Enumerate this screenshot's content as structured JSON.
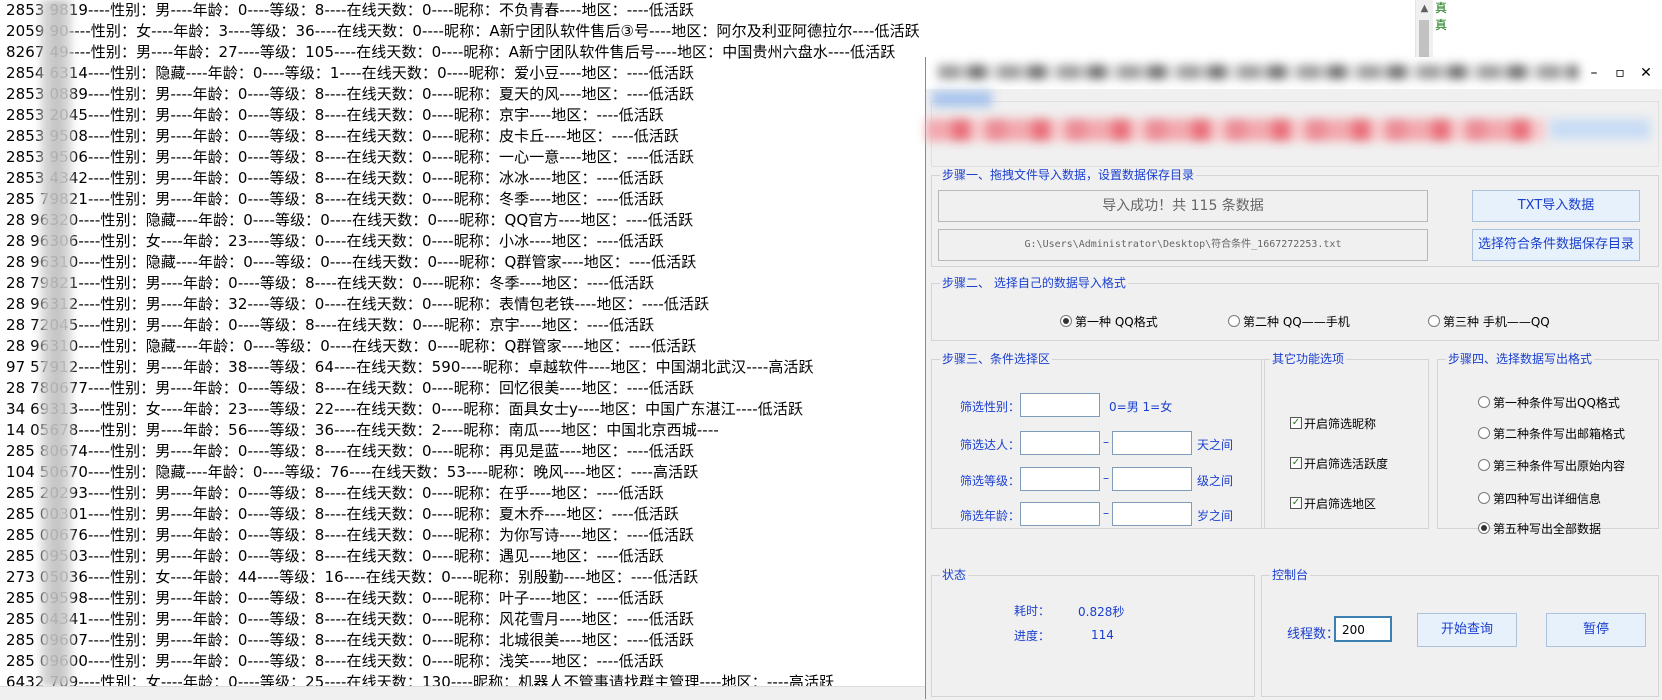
{
  "log_lines": [
    "2853  9819----性别：男----年龄：0----等级：8----在线天数：0----昵称：不负青春----地区：----低活跃",
    "2059  90----性别：女----年龄：3----等级：36----在线天数：0----昵称：A新宁团队软件售后③号----地区：阿尔及利亚阿德拉尔----低活跃",
    "8267  49----性别：男----年龄：27----等级：105----在线天数：0----昵称：A新宁团队软件售后号----地区：中国贵州六盘水----低活跃",
    "2854  6314----性别：隐藏----年龄：0----等级：1----在线天数：0----昵称：爱小豆----地区：----低活跃",
    "2853  0889----性别：男----年龄：0----等级：8----在线天数：0----昵称：夏天的风----地区：----低活跃",
    "2853  2045----性别：男----年龄：0----等级：8----在线天数：0----昵称：京宇----地区：----低活跃",
    "2853  9508----性别：男----年龄：0----等级：8----在线天数：0----昵称：皮卡丘----地区：----低活跃",
    "2853  9506----性别：男----年龄：0----等级：8----在线天数：0----昵称：一心一意----地区：----低活跃",
    "2853  4342----性别：男----年龄：0----等级：8----在线天数：0----昵称：冰冰----地区：----低活跃",
    "285  79821----性别：男----年龄：0----等级：8----在线天数：0----昵称：冬季----地区：----低活跃",
    "28  96320----性别：隐藏----年龄：0----等级：0----在线天数：0----昵称：QQ官方----地区：----低活跃",
    "28  96306----性别：女----年龄：23----等级：0----在线天数：0----昵称：小冰----地区：----低活跃",
    "28  96310----性别：隐藏----年龄：0----等级：0----在线天数：0----昵称：Q群管家----地区：----低活跃",
    "28  79821----性别：男----年龄：0----等级：8----在线天数：0----昵称：冬季----地区：----低活跃",
    "28  96312----性别：男----年龄：32----等级：0----在线天数：0----昵称：表情包老铁----地区：----低活跃",
    "28  72045----性别：男----年龄：0----等级：8----在线天数：0----昵称：京宇----地区：----低活跃",
    "28  96310----性别：隐藏----年龄：0----等级：0----在线天数：0----昵称：Q群管家----地区：----低活跃",
    "97  57912----性别：男----年龄：38----等级：64----在线天数：590----昵称：卓越软件----地区：中国湖北武汉----高活跃",
    "28  780677----性别：男----年龄：0----等级：8----在线天数：0----昵称：回忆很美----地区：----低活跃",
    "34  69313----性别：女----年龄：23----等级：22----在线天数：0----昵称：面具女士y----地区：中国广东湛江----低活跃",
    "14  05678----性别：男----年龄：56----等级：36----在线天数：2----昵称：南瓜----地区：中国北京西城----",
    "285  80674----性别：男----年龄：0----等级：8----在线天数：0----昵称：再见是蓝----地区：----低活跃",
    "104  50670----性别：隐藏----年龄：0----等级：76----在线天数：53----昵称：晚风----地区：----高活跃",
    "285  20293----性别：男----年龄：0----等级：8----在线天数：0----昵称：在乎----地区：----低活跃",
    "285  00301----性别：男----年龄：0----等级：8----在线天数：0----昵称：夏木乔----地区：----低活跃",
    "285  00676----性别：男----年龄：0----等级：8----在线天数：0----昵称：为你写诗----地区：----低活跃",
    "285  09503----性别：男----年龄：0----等级：8----在线天数：0----昵称：遇见----地区：----低活跃",
    "273  05036----性别：女----年龄：44----等级：16----在线天数：0----昵称：别殷勤----地区：----低活跃",
    "285  09598----性别：男----年龄：0----等级：8----在线天数：0----昵称：叶子----地区：----低活跃",
    "285  04341----性别：男----年龄：0----等级：8----在线天数：0----昵称：风花雪月----地区：----低活跃",
    "285  09607----性别：男----年龄：0----等级：8----在线天数：0----昵称：北城很美----地区：----低活跃",
    "285  09600----性别：男----年龄：0----等级：8----在线天数：0----昵称：浅笑----地区：----低活跃",
    "6432  709----性别：女----年龄：0----等级：25----在线天数：130----昵称：机器人不管事请找群主管理----地区：----高活跃"
  ],
  "side_labels": [
    "真",
    "真"
  ],
  "window": {
    "step1": {
      "title": "步骤一、拖拽文件导入数据，设置数据保存目录",
      "import_status": "导入成功！共 115 条数据",
      "save_path": "G:\\Users\\Administrator\\Desktop\\符合条件_1667272253.txt",
      "import_button": "TXT导入数据",
      "save_dir_button": "选择符合条件数据保存目录"
    },
    "step2": {
      "title": "步骤二、    选择自己的数据导入格式",
      "options": [
        "第一种 QQ格式",
        "第二种 QQ——手机",
        "第三种 手机——QQ"
      ]
    },
    "step3": {
      "title": "步骤三、条件选择区",
      "gender_label": "筛选性别：",
      "gender_hint": "0=男  1=女",
      "fans_label": "筛选达人：",
      "fans_suffix": "天之间",
      "level_label": "筛选等级：",
      "level_suffix": "级之间",
      "age_label": "筛选年龄：",
      "age_suffix": "岁之间",
      "dash": "–"
    },
    "other": {
      "title": "其它功能选项",
      "options": [
        "开启筛选昵称",
        "开启筛选活跃度",
        "开启筛选地区"
      ],
      "checkmark": "✓"
    },
    "step4": {
      "title": "步骤四、选择数据写出格式",
      "options": [
        "第一种条件写出QQ格式",
        "第二种条件写出邮箱格式",
        "第三种条件写出原始内容",
        "第四种写出详细信息",
        "第五种写出全部数据"
      ]
    },
    "status": {
      "title": "状态",
      "time_label": "耗时：",
      "time_value": "0.828秒",
      "progress_label": "进度：",
      "progress_value": "114"
    },
    "console": {
      "title": "控制台",
      "threads_label": "线程数：",
      "threads_value": "200",
      "start_button": "开始查询",
      "pause_button": "暂停"
    },
    "controls": {
      "minimize": "–",
      "maximize": "▫",
      "close": "✕"
    }
  }
}
